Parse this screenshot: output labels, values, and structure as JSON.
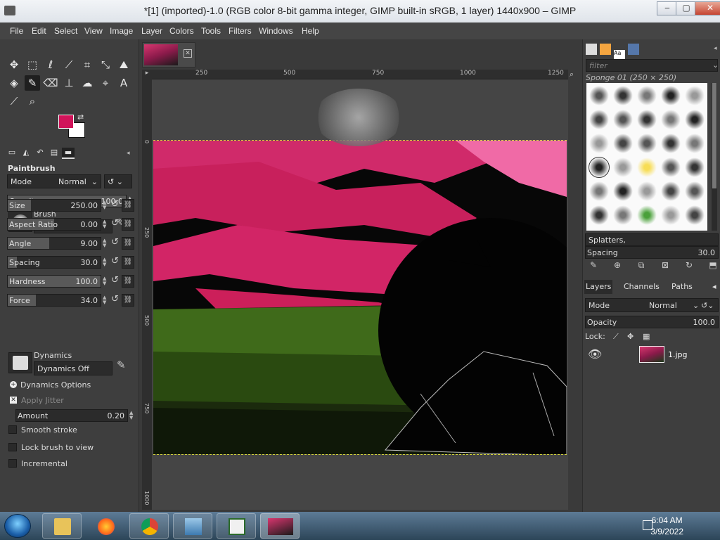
{
  "window": {
    "title": "*[1] (imported)-1.0 (RGB color 8-bit gamma integer, GIMP built-in sRGB, 1 layer) 1440x900 – GIMP",
    "minimize": "‒",
    "maximize": "▢",
    "close": "✕"
  },
  "menu": [
    "File",
    "Edit",
    "Select",
    "View",
    "Image",
    "Layer",
    "Colors",
    "Tools",
    "Filters",
    "Windows",
    "Help"
  ],
  "colors": {
    "foreground": "#d0145a",
    "background": "#ffffff"
  },
  "tool_options": {
    "title": "Paintbrush",
    "mode_label": "Mode",
    "mode_value": "Normal",
    "opacity_label": "Opacity",
    "opacity_value": "100.0",
    "brush_label": "Brush",
    "brush_value": "Sponge 01",
    "sliders": [
      {
        "label": "Size",
        "value": "250.00",
        "fill": 0.25
      },
      {
        "label": "Aspect Ratio",
        "value": "0.00",
        "fill": 0.5
      },
      {
        "label": "Angle",
        "value": "9.00",
        "fill": 0.45
      },
      {
        "label": "Spacing",
        "value": "30.0",
        "fill": 0.1
      },
      {
        "label": "Hardness",
        "value": "100.0",
        "fill": 1.0
      },
      {
        "label": "Force",
        "value": "34.0",
        "fill": 0.3
      }
    ],
    "dynamics_label": "Dynamics",
    "dynamics_value": "Dynamics Off",
    "dynamics_options": "Dynamics Options",
    "apply_jitter": "Apply Jitter",
    "amount_label": "Amount",
    "amount_value": "0.20",
    "smooth_stroke": "Smooth stroke",
    "lock_brush": "Lock brush to view",
    "incremental": "Incremental"
  },
  "image_tab": {
    "close": "✕"
  },
  "ruler": {
    "h": [
      "250",
      "500",
      "750",
      "1000",
      "1250"
    ],
    "v": [
      "0",
      "250",
      "500",
      "750",
      "1000"
    ]
  },
  "brushes": {
    "filter_placeholder": "filter",
    "caption": "Sponge 01 (250 × 250)",
    "tag": "Splatters,",
    "spacing_label": "Spacing",
    "spacing_value": "30.0"
  },
  "layers": {
    "tabs": [
      "Layers",
      "Channels",
      "Paths"
    ],
    "mode_label": "Mode",
    "mode_value": "Normal",
    "opacity_label": "Opacity",
    "opacity_value": "100.0",
    "lock_label": "Lock:",
    "layer_name": "1.jpg"
  },
  "taskbar": {
    "time": "6:04 AM",
    "date": "3/9/2022"
  }
}
